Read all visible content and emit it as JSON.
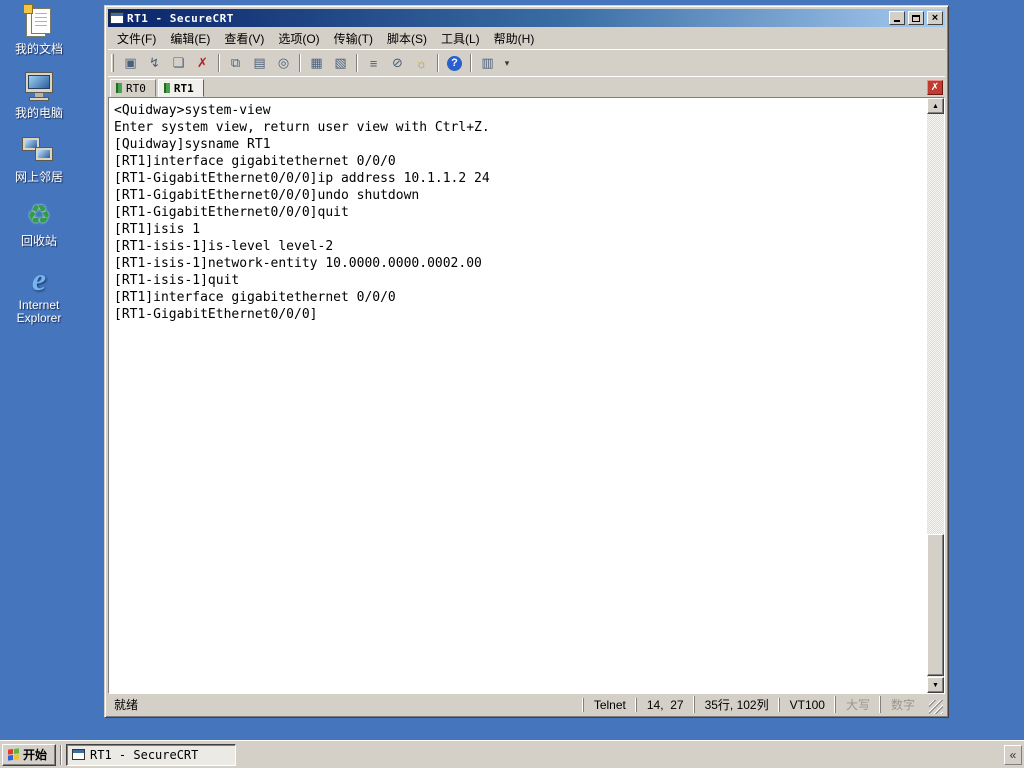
{
  "desktop": {
    "icons": [
      {
        "label": "我的文档"
      },
      {
        "label": "我的电脑"
      },
      {
        "label": "网上邻居"
      },
      {
        "label": "回收站"
      },
      {
        "label": "Internet Explorer"
      }
    ]
  },
  "window": {
    "title": "RT1 - SecureCRT",
    "titlebar_buttons": {
      "minimize": "",
      "maximize": "",
      "close": "×"
    },
    "menu": [
      "文件(F)",
      "编辑(E)",
      "查看(V)",
      "选项(O)",
      "传输(T)",
      "脚本(S)",
      "工具(L)",
      "帮助(H)"
    ],
    "toolbar": {
      "icons": [
        {
          "name": "connect-icon",
          "glyph": "▣"
        },
        {
          "name": "quick-connect-icon",
          "glyph": "↯"
        },
        {
          "name": "clone-session-icon",
          "glyph": "❏"
        },
        {
          "name": "disconnect-icon",
          "glyph": "✗"
        },
        {
          "name": "copy-icon",
          "glyph": "⧉"
        },
        {
          "name": "paste-icon",
          "glyph": "▤"
        },
        {
          "name": "find-icon",
          "glyph": "◎"
        },
        {
          "name": "print-icon",
          "glyph": "▦"
        },
        {
          "name": "print-setup-icon",
          "glyph": "▧"
        },
        {
          "name": "session-options-icon",
          "glyph": "≡"
        },
        {
          "name": "clear-screen-icon",
          "glyph": "⊘"
        },
        {
          "name": "light-icon",
          "glyph": "☼"
        },
        {
          "name": "help-icon",
          "glyph": "?"
        },
        {
          "name": "session-manager-icon",
          "glyph": "▥"
        }
      ],
      "overflow_glyph": "▾"
    },
    "tabs": [
      {
        "label": "RT0",
        "active": false
      },
      {
        "label": "RT1",
        "active": true
      }
    ],
    "tabbar_close_glyph": "✗",
    "terminal": {
      "text": "<Quidway>system-view\nEnter system view, return user view with Ctrl+Z.\n[Quidway]sysname RT1\n[RT1]interface gigabitethernet 0/0/0\n[RT1-GigabitEthernet0/0/0]ip address 10.1.1.2 24\n[RT1-GigabitEthernet0/0/0]undo shutdown\n[RT1-GigabitEthernet0/0/0]quit\n[RT1]isis 1\n[RT1-isis-1]is-level level-2\n[RT1-isis-1]network-entity 10.0000.0000.0002.00\n[RT1-isis-1]quit\n[RT1]interface gigabitethernet 0/0/0\n[RT1-GigabitEthernet0/0/0]"
    },
    "scrollbar": {
      "up_glyph": "▲",
      "down_glyph": "▼"
    },
    "statusbar": {
      "ready": "就绪",
      "protocol": "Telnet",
      "cursor": "14,  27",
      "size": "35行, 102列",
      "emulation": "VT100",
      "caps": "大写",
      "num": "数字"
    }
  },
  "taskbar": {
    "start_label": "开始",
    "items": [
      {
        "label": "RT1 - SecureCRT"
      }
    ],
    "chevrons": "«"
  }
}
